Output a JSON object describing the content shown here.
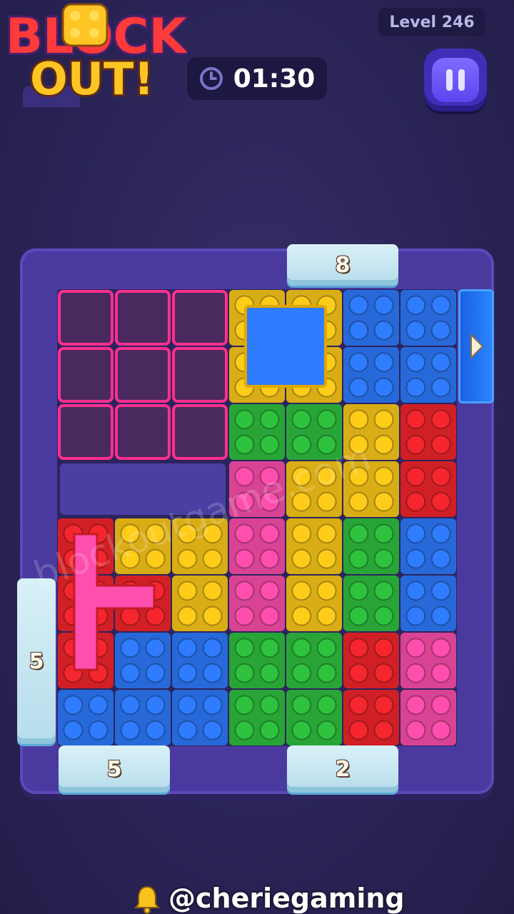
{
  "header": {
    "logo_text_line1": "BLOCK",
    "logo_text_line2": "OUT!",
    "level_label": "Level 246",
    "timer_value": "01:30",
    "clock_icon": "clock-icon",
    "pause_icon": "pause-icon"
  },
  "board": {
    "grid_cols": 7,
    "grid_rows": 8,
    "gates": [
      {
        "id": "top-gate",
        "count": "8"
      },
      {
        "id": "left-gate",
        "count": "5"
      },
      {
        "id": "bottom-left-gate",
        "count": "5"
      },
      {
        "id": "bottom-right-gate",
        "count": "2"
      }
    ],
    "exit_arrow_icon": "play-arrow-icon",
    "pieces": [
      {
        "name": "pink-empty-3x3",
        "color": "#ff2f8f",
        "cells": [
          [
            0,
            0
          ],
          [
            1,
            0
          ],
          [
            2,
            0
          ],
          [
            0,
            1
          ],
          [
            1,
            1
          ],
          [
            2,
            1
          ],
          [
            0,
            2
          ],
          [
            1,
            2
          ],
          [
            2,
            2
          ]
        ],
        "hollow": true
      },
      {
        "name": "yellow-frame",
        "color": "#ffcc1a",
        "cells": [
          [
            3,
            0
          ],
          [
            4,
            0
          ],
          [
            3,
            1
          ],
          [
            4,
            1
          ]
        ]
      },
      {
        "name": "blue-2x2-top",
        "color": "#2f7cff",
        "cells": [
          [
            5,
            0
          ],
          [
            6,
            0
          ],
          [
            5,
            1
          ],
          [
            6,
            1
          ]
        ]
      },
      {
        "name": "green-2x1",
        "color": "#2fc23f",
        "cells": [
          [
            3,
            2
          ],
          [
            4,
            2
          ]
        ]
      },
      {
        "name": "yellow-1x2",
        "color": "#ffcc1a",
        "cells": [
          [
            5,
            2
          ],
          [
            5,
            3
          ]
        ]
      },
      {
        "name": "red-1x2",
        "color": "#f5262d",
        "cells": [
          [
            6,
            2
          ],
          [
            6,
            3
          ]
        ]
      },
      {
        "name": "pink-1x3",
        "color": "#ff4fae",
        "cells": [
          [
            3,
            3
          ],
          [
            3,
            4
          ],
          [
            3,
            5
          ]
        ]
      },
      {
        "name": "yellow-1x3",
        "color": "#ffcc1a",
        "cells": [
          [
            4,
            3
          ],
          [
            4,
            4
          ],
          [
            4,
            5
          ]
        ]
      },
      {
        "name": "red-L",
        "color": "#f5262d",
        "cells": [
          [
            0,
            4
          ],
          [
            0,
            5
          ],
          [
            0,
            6
          ],
          [
            1,
            5
          ]
        ]
      },
      {
        "name": "yellow-S",
        "color": "#ffcc1a",
        "cells": [
          [
            1,
            4
          ],
          [
            2,
            4
          ],
          [
            2,
            5
          ]
        ]
      },
      {
        "name": "green-1x2",
        "color": "#2fc23f",
        "cells": [
          [
            5,
            4
          ],
          [
            5,
            5
          ]
        ]
      },
      {
        "name": "blue-1x2",
        "color": "#2f7cff",
        "cells": [
          [
            6,
            4
          ],
          [
            6,
            5
          ]
        ]
      },
      {
        "name": "blue-L-bottom",
        "color": "#2f7cff",
        "cells": [
          [
            1,
            6
          ],
          [
            2,
            6
          ],
          [
            0,
            7
          ],
          [
            1,
            7
          ],
          [
            2,
            7
          ]
        ]
      },
      {
        "name": "green-2x2",
        "color": "#2fc23f",
        "cells": [
          [
            3,
            6
          ],
          [
            4,
            6
          ],
          [
            3,
            7
          ],
          [
            4,
            7
          ]
        ]
      },
      {
        "name": "red-2x2",
        "color": "#f5262d",
        "cells": [
          [
            5,
            6
          ],
          [
            6,
            6
          ],
          [
            5,
            7
          ],
          [
            6,
            7
          ]
        ]
      },
      {
        "name": "pink-1x2",
        "color": "#ff4fae",
        "cells": [
          [
            6,
            6
          ],
          [
            6,
            7
          ]
        ]
      }
    ],
    "empty_slot_row": "purple-slot"
  },
  "footer": {
    "handle": "@cheriegaming",
    "bell_icon": "bell-icon"
  },
  "watermark": "blockoutgame.com",
  "colors": {
    "background": "#2b2558",
    "board": "#4a3aa0",
    "accent_pause": "#5b46ef"
  }
}
